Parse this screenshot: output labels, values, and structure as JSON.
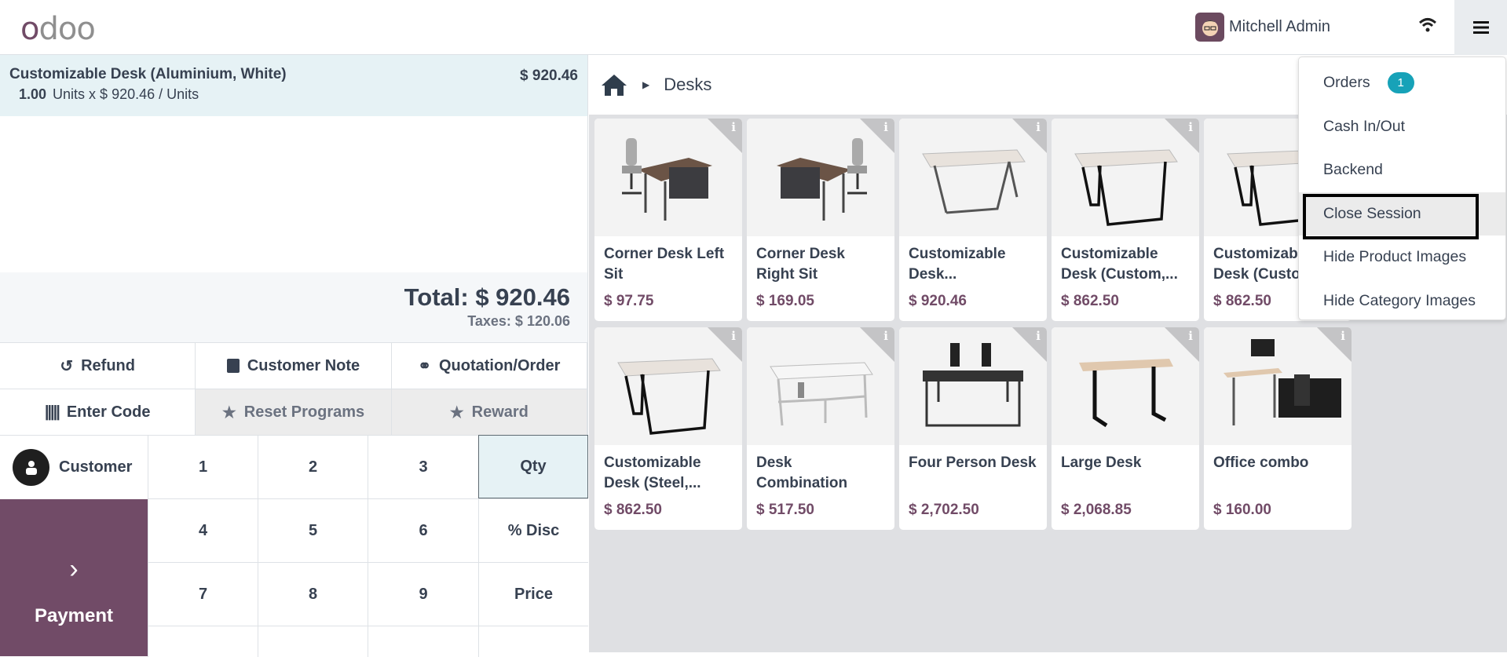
{
  "header": {
    "logo": "odoo",
    "user": "Mitchell Admin",
    "wifi_icon": "wifi-icon",
    "menu_icon": "hamburger-icon"
  },
  "order": {
    "line": {
      "name": "Customizable Desk (Aluminium, White)",
      "price": "$ 920.46",
      "qty": "1.00",
      "unit_text": "Units x $ 920.46 / Units"
    },
    "total": "Total: $ 920.46",
    "taxes": "Taxes: $ 120.06"
  },
  "actions": {
    "refund": "Refund",
    "customer_note": "Customer Note",
    "quotation": "Quotation/Order",
    "enter_code": "Enter Code",
    "reset_programs": "Reset Programs",
    "reward": "Reward"
  },
  "pad": {
    "customer": "Customer",
    "payment": "Payment",
    "keys": [
      "1",
      "2",
      "3",
      "Qty",
      "4",
      "5",
      "6",
      "% Disc",
      "7",
      "8",
      "9",
      "Price"
    ],
    "selected": "Qty"
  },
  "breadcrumb": {
    "home_icon": "home-icon",
    "category": "Desks"
  },
  "products": [
    {
      "name": "Corner Desk Left Sit",
      "price": "$ 97.75",
      "kind": "corner-left"
    },
    {
      "name": "Corner Desk Right Sit",
      "price": "$ 169.05",
      "kind": "corner-right"
    },
    {
      "name": "Customizable Desk...",
      "price": "$ 920.46",
      "kind": "table-white"
    },
    {
      "name": "Customizable Desk (Custom,...",
      "price": "$ 862.50",
      "kind": "table-black"
    },
    {
      "name": "Customizable Desk (Custom,...",
      "price": "$ 862.50",
      "kind": "table-black"
    },
    {
      "name": "Customizable Desk (Steel,...",
      "price": "$ 862.50",
      "kind": "table-black"
    },
    {
      "name": "Desk Combination",
      "price": "$ 517.50",
      "kind": "white-frame"
    },
    {
      "name": "Four Person Desk",
      "price": "$ 2,702.50",
      "kind": "four"
    },
    {
      "name": "Large Desk",
      "price": "$ 2,068.85",
      "kind": "standing"
    },
    {
      "name": "Office combo",
      "price": "$ 160.00",
      "kind": "combo"
    }
  ],
  "menu": {
    "items": [
      "Orders",
      "Cash In/Out",
      "Backend",
      "Close Session",
      "Hide Product Images",
      "Hide Category Images"
    ],
    "orders_badge": "1",
    "highlighted": "Close Session"
  },
  "colors": {
    "brand": "#714b67",
    "badge": "#17a2b8",
    "selected_line": "#e6f2f5"
  }
}
